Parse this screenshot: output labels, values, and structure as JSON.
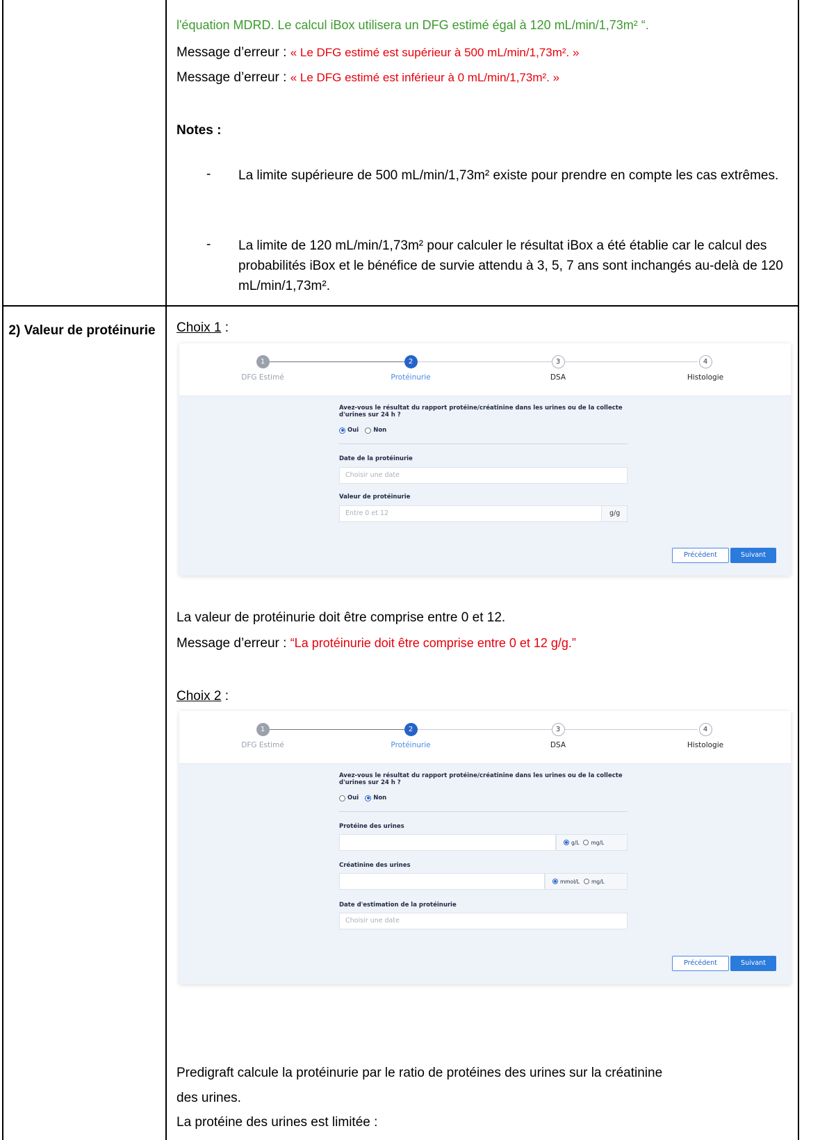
{
  "top_section": {
    "line_green": "l'équation MDRD. Le calcul iBox utilisera un DFG estimé égal à 120 mL/min/1,73m² “.",
    "error_label": "Message d’erreur : ",
    "error_1": "« Le DFG estimé est supérieur à 500 mL/min/1,73m². »",
    "error_2": "« Le DFG estimé est inférieur à 0 mL/min/1,73m². »",
    "notes_title": "Notes :",
    "note_1": "La limite supérieure de 500 mL/min/1,73m² existe pour prendre en compte les cas extrêmes.",
    "note_2": "La limite de 120 mL/min/1,73m² pour calculer le résultat iBox a été établie car le calcul des probabilités iBox et le bénéfice de survie attendu à 3, 5, 7 ans sont inchangés au-delà de 120 mL/min/1,73m².",
    "dash": "-"
  },
  "row2": {
    "title": "2) Valeur de protéinurie",
    "choix1": "Choix 1",
    "choix2": "Choix 2",
    "colon": " :",
    "range_text": "La valeur de protéinurie doit être comprise entre 0 et 12.",
    "error_label": "Message d’erreur : ",
    "range_error": "“La protéinurie doit être comprise entre 0 et 12 g/g.”",
    "predigraft_text_1": "Predigraft calcule la protéinurie par le ratio de protéines des urines sur la créatinine",
    "predigraft_text_2": "des urines.",
    "limit_text": "La protéine des urines est limitée :"
  },
  "app": {
    "steps": [
      {
        "num": "1",
        "label": "DFG Estimé"
      },
      {
        "num": "2",
        "label": "Protéinurie"
      },
      {
        "num": "3",
        "label": "DSA"
      },
      {
        "num": "4",
        "label": "Histologie"
      }
    ],
    "question": "Avez-vous le résultat du rapport protéine/créatinine dans les urines ou de la collecte d'urines sur 24 h ?",
    "oui": "Oui",
    "non": "Non",
    "prev": "Précédent",
    "next": "Suivant",
    "choice1": {
      "date_label": "Date de la protéinurie",
      "date_placeholder": "Choisir une date",
      "value_label": "Valeur de protéinurie",
      "value_placeholder": "Entre 0 et 12",
      "value_unit": "g/g"
    },
    "choice2": {
      "protein_label": "Protéine des urines",
      "protein_unit_1": "g/L",
      "protein_unit_2": "mg/L",
      "creat_label": "Créatinine des urines",
      "creat_unit_1": "mmol/L",
      "creat_unit_2": "mg/L",
      "date_label": "Date d'estimation de la protéinurie",
      "date_placeholder": "Choisir une date"
    }
  }
}
